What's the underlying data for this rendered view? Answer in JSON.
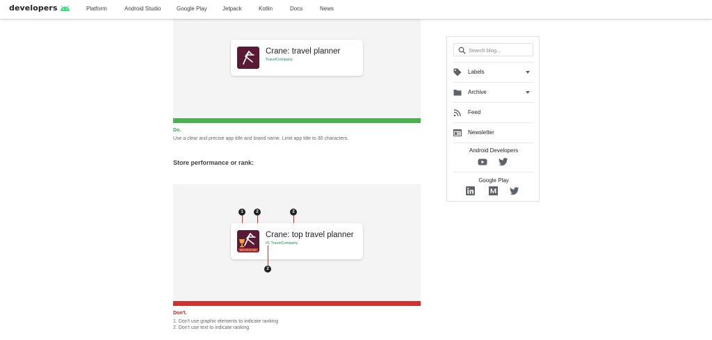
{
  "header": {
    "logo_text": "developers",
    "nav": [
      "Platform",
      "Android Studio",
      "Google Play",
      "Jetpack",
      "Kotlin",
      "Docs",
      "News"
    ]
  },
  "examples": [
    {
      "card": {
        "title": "Crane: travel planner",
        "subtitle": "TravelCompany"
      },
      "verdict": "Do.",
      "verdict_color": "#34a853",
      "bar_color": "#4caf50",
      "notes": [
        "Use a clear and precise app title and brand name. Limit app title to 30 characters."
      ]
    },
    {
      "card": {
        "title": "Crane: top travel planner",
        "subtitle": "#1 TravelCompany",
        "badge_text": "BEST APP OF 2019"
      },
      "markers": [
        "1",
        "2",
        "2",
        "2"
      ],
      "verdict": "Don't.",
      "verdict_color": "#c5221f",
      "bar_color": "#d32f2f",
      "notes": [
        "1.  Don't use graphic elements to indicate ranking",
        "2.  Don't use text to indicate ranking"
      ]
    }
  ],
  "section_heading": "Store performance or rank:",
  "sidebar": {
    "search_placeholder": "Search blog...",
    "items": [
      {
        "label": "Labels",
        "icon": "tag-icon",
        "dropdown": true
      },
      {
        "label": "Archive",
        "icon": "folder-icon",
        "dropdown": true
      },
      {
        "label": "Feed",
        "icon": "rss-icon",
        "dropdown": false
      },
      {
        "label": "Newsletter",
        "icon": "newsletter-icon",
        "dropdown": false
      }
    ],
    "android_developers": {
      "title": "Android Developers",
      "icons": [
        "youtube-icon",
        "twitter-icon"
      ]
    },
    "google_play": {
      "title": "Google Play",
      "icons": [
        "linkedin-icon",
        "medium-icon",
        "twitter-icon"
      ]
    }
  },
  "colors": {
    "brand_green": "#3ddc84",
    "icon_gray": "#5f6368"
  }
}
